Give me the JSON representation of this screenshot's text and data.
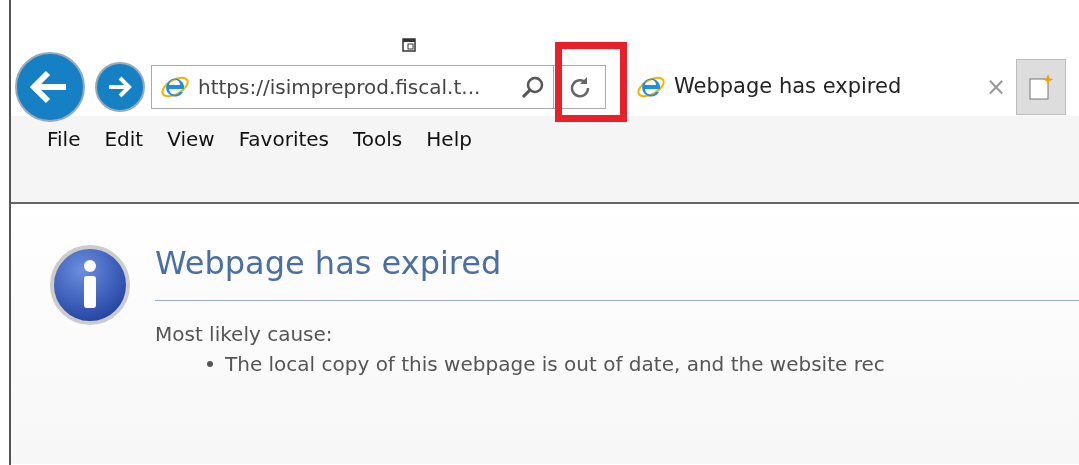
{
  "address_bar": {
    "url": "https://isimpreprod.fiscal.t..."
  },
  "tabs": [
    {
      "label": "Webpage has expired",
      "selected": true,
      "close": "×"
    }
  ],
  "menu": [
    "File",
    "Edit",
    "View",
    "Favorites",
    "Tools",
    "Help"
  ],
  "page": {
    "heading": "Webpage has expired",
    "cause_label": "Most likely cause:",
    "causes": [
      "The local copy of this webpage is out of date, and the website rec"
    ]
  }
}
